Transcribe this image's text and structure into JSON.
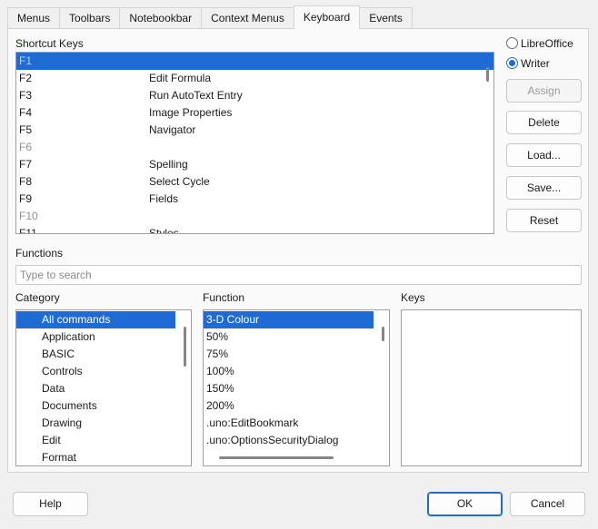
{
  "tabs": [
    {
      "label": "Menus",
      "active": false
    },
    {
      "label": "Toolbars",
      "active": false
    },
    {
      "label": "Notebookbar",
      "active": false
    },
    {
      "label": "Context Menus",
      "active": false
    },
    {
      "label": "Keyboard",
      "active": true
    },
    {
      "label": "Events",
      "active": false
    }
  ],
  "shortcut_keys": {
    "label": "Shortcut Keys",
    "rows": [
      {
        "key": "F1",
        "function": "",
        "selected": true,
        "dimmed": false
      },
      {
        "key": "F2",
        "function": "Edit Formula",
        "selected": false,
        "dimmed": false
      },
      {
        "key": "F3",
        "function": "Run AutoText Entry",
        "selected": false,
        "dimmed": false
      },
      {
        "key": "F4",
        "function": "Image Properties",
        "selected": false,
        "dimmed": false
      },
      {
        "key": "F5",
        "function": "Navigator",
        "selected": false,
        "dimmed": false
      },
      {
        "key": "F6",
        "function": "",
        "selected": false,
        "dimmed": true
      },
      {
        "key": "F7",
        "function": "Spelling",
        "selected": false,
        "dimmed": false
      },
      {
        "key": "F8",
        "function": "Select Cycle",
        "selected": false,
        "dimmed": false
      },
      {
        "key": "F9",
        "function": "Fields",
        "selected": false,
        "dimmed": false
      },
      {
        "key": "F10",
        "function": "",
        "selected": false,
        "dimmed": true
      },
      {
        "key": "F11",
        "function": "Styles",
        "selected": false,
        "dimmed": false
      }
    ]
  },
  "scope": {
    "libreoffice_label": "LibreOffice",
    "writer_label": "Writer",
    "selected": "Writer"
  },
  "side_buttons": {
    "assign": "Assign",
    "delete": "Delete",
    "load": "Load...",
    "save": "Save...",
    "reset": "Reset"
  },
  "functions": {
    "label": "Functions",
    "search_placeholder": "Type to search",
    "category_label": "Category",
    "function_label": "Function",
    "keys_label": "Keys",
    "categories": [
      {
        "label": "All commands",
        "selected": true
      },
      {
        "label": "Application",
        "selected": false
      },
      {
        "label": "BASIC",
        "selected": false
      },
      {
        "label": "Controls",
        "selected": false
      },
      {
        "label": "Data",
        "selected": false
      },
      {
        "label": "Documents",
        "selected": false
      },
      {
        "label": "Drawing",
        "selected": false
      },
      {
        "label": "Edit",
        "selected": false
      },
      {
        "label": "Format",
        "selected": false
      }
    ],
    "function_list": [
      {
        "label": "3-D Colour",
        "selected": true
      },
      {
        "label": "50%",
        "selected": false
      },
      {
        "label": "75%",
        "selected": false
      },
      {
        "label": "100%",
        "selected": false
      },
      {
        "label": "150%",
        "selected": false
      },
      {
        "label": "200%",
        "selected": false
      },
      {
        "label": ".uno:EditBookmark",
        "selected": false
      },
      {
        "label": ".uno:OptionsSecurityDialog",
        "selected": false
      }
    ],
    "keys": []
  },
  "footer": {
    "help": "Help",
    "ok": "OK",
    "cancel": "Cancel"
  },
  "colors": {
    "selection": "#1e6bd6",
    "panel": "#fafafa",
    "dialog": "#f0f0f0"
  }
}
